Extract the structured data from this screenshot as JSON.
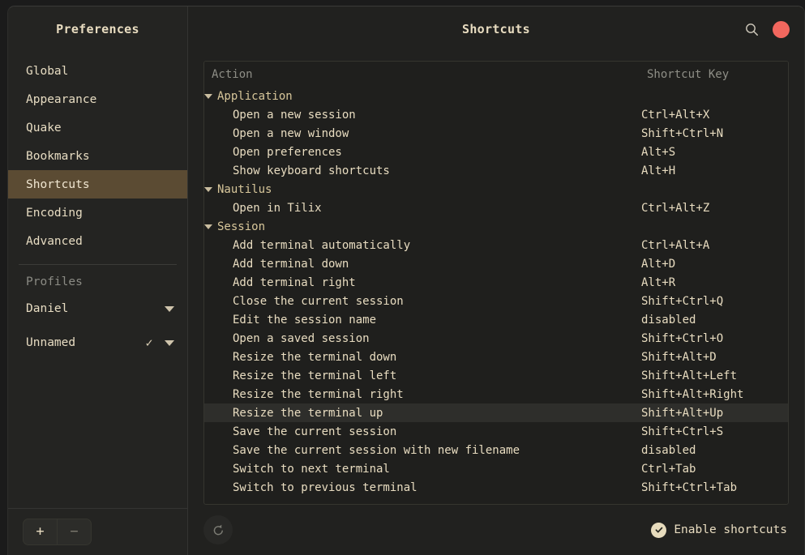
{
  "window": {
    "sidebar_title": "Preferences",
    "header_title": "Shortcuts"
  },
  "sidebar": {
    "items": [
      {
        "label": "Global",
        "selected": false
      },
      {
        "label": "Appearance",
        "selected": false
      },
      {
        "label": "Quake",
        "selected": false
      },
      {
        "label": "Bookmarks",
        "selected": false
      },
      {
        "label": "Shortcuts",
        "selected": true
      },
      {
        "label": "Encoding",
        "selected": false
      },
      {
        "label": "Advanced",
        "selected": false
      }
    ],
    "profiles_label": "Profiles",
    "profiles": [
      {
        "name": "Daniel",
        "checked": false,
        "check_glyph": ""
      },
      {
        "name": "Unnamed",
        "checked": true,
        "check_glyph": "✓"
      }
    ],
    "add_button_label": "+",
    "remove_button_label": "−"
  },
  "headerbar": {
    "search_icon": "search-icon",
    "close_icon": "close-window-dot",
    "close_color": "#f2675e"
  },
  "table": {
    "columns": [
      "Action",
      "Shortcut Key"
    ],
    "rows": [
      {
        "type": "group",
        "action": "Application",
        "key": "",
        "selected": false
      },
      {
        "type": "item",
        "action": "Open a new session",
        "key": "Ctrl+Alt+X",
        "selected": false
      },
      {
        "type": "item",
        "action": "Open a new window",
        "key": "Shift+Ctrl+N",
        "selected": false
      },
      {
        "type": "item",
        "action": "Open preferences",
        "key": "Alt+S",
        "selected": false
      },
      {
        "type": "item",
        "action": "Show keyboard shortcuts",
        "key": "Alt+H",
        "selected": false
      },
      {
        "type": "group",
        "action": "Nautilus",
        "key": "",
        "selected": false
      },
      {
        "type": "item",
        "action": "Open in Tilix",
        "key": "Ctrl+Alt+Z",
        "selected": false
      },
      {
        "type": "group",
        "action": "Session",
        "key": "",
        "selected": false
      },
      {
        "type": "item",
        "action": "Add terminal automatically",
        "key": "Ctrl+Alt+A",
        "selected": false
      },
      {
        "type": "item",
        "action": "Add terminal down",
        "key": "Alt+D",
        "selected": false
      },
      {
        "type": "item",
        "action": "Add terminal right",
        "key": "Alt+R",
        "selected": false
      },
      {
        "type": "item",
        "action": "Close the current session",
        "key": "Shift+Ctrl+Q",
        "selected": false
      },
      {
        "type": "item",
        "action": "Edit the session name",
        "key": "disabled",
        "selected": false
      },
      {
        "type": "item",
        "action": "Open a saved session",
        "key": "Shift+Ctrl+O",
        "selected": false
      },
      {
        "type": "item",
        "action": "Resize the terminal down",
        "key": "Shift+Alt+D",
        "selected": false
      },
      {
        "type": "item",
        "action": "Resize the terminal left",
        "key": "Shift+Alt+Left",
        "selected": false
      },
      {
        "type": "item",
        "action": "Resize the terminal right",
        "key": "Shift+Alt+Right",
        "selected": false
      },
      {
        "type": "item",
        "action": "Resize the terminal up",
        "key": "Shift+Alt+Up",
        "selected": true
      },
      {
        "type": "item",
        "action": "Save the current session",
        "key": "Shift+Ctrl+S",
        "selected": false
      },
      {
        "type": "item",
        "action": "Save the current session with new filename",
        "key": "disabled",
        "selected": false
      },
      {
        "type": "item",
        "action": "Switch to next terminal",
        "key": "Ctrl+Tab",
        "selected": false
      },
      {
        "type": "item",
        "action": "Switch to previous terminal",
        "key": "Shift+Ctrl+Tab",
        "selected": false
      }
    ]
  },
  "bottombar": {
    "reset_icon": "undo-arrow-icon",
    "enable_shortcuts_label": "Enable shortcuts",
    "enable_shortcuts_checked": true
  }
}
